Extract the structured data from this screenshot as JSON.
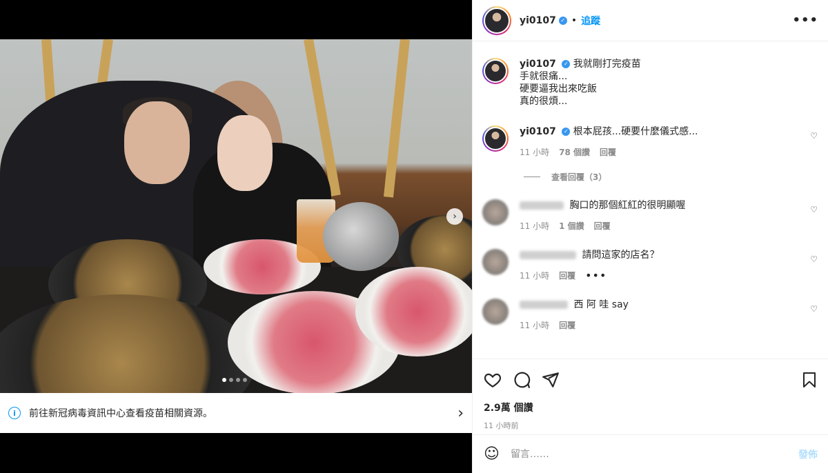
{
  "post": {
    "username": "yi0107",
    "follow_label": "追蹤",
    "more_label": "•••",
    "info_banner": "前往新冠病毒資訊中心查看疫苗相關資源。",
    "carousel_index": 1,
    "carousel_total": 4
  },
  "caption": {
    "username": "yi0107",
    "lines": [
      "我就剛打完疫苗",
      "手就很痛...",
      "硬要逼我出來吃飯",
      "真的很煩..."
    ]
  },
  "comments": [
    {
      "username": "yi0107",
      "text": "根本屁孩...硬要什麼儀式感...",
      "time": "11 小時",
      "likes": "78 個讚",
      "reply_label": "回覆",
      "view_replies": "查看回覆（3）"
    },
    {
      "text": "胸口的那個紅紅的很明顯喔",
      "time": "11 小時",
      "likes": "1 個讚",
      "reply_label": "回覆"
    },
    {
      "text": "請問這家的店名？",
      "time": "11 小時",
      "reply_label": "回覆",
      "more_label": "•••"
    },
    {
      "text": "西 阿 哇 say",
      "time": "11 小時",
      "reply_label": "回覆"
    }
  ],
  "actions": {
    "likes": "2.9萬 個讚",
    "posted_time": "11 小時前"
  },
  "add_comment": {
    "placeholder": "留言……",
    "post_label": "發佈",
    "emoji": "☺"
  },
  "colors": {
    "accent": "#0095f6",
    "verified": "#3897f0",
    "muted": "#8e8e8e"
  },
  "icons": [
    "heart-icon",
    "comment-icon",
    "share-icon",
    "bookmark-icon",
    "info-icon",
    "chevron-right-icon",
    "verified-badge-icon"
  ]
}
